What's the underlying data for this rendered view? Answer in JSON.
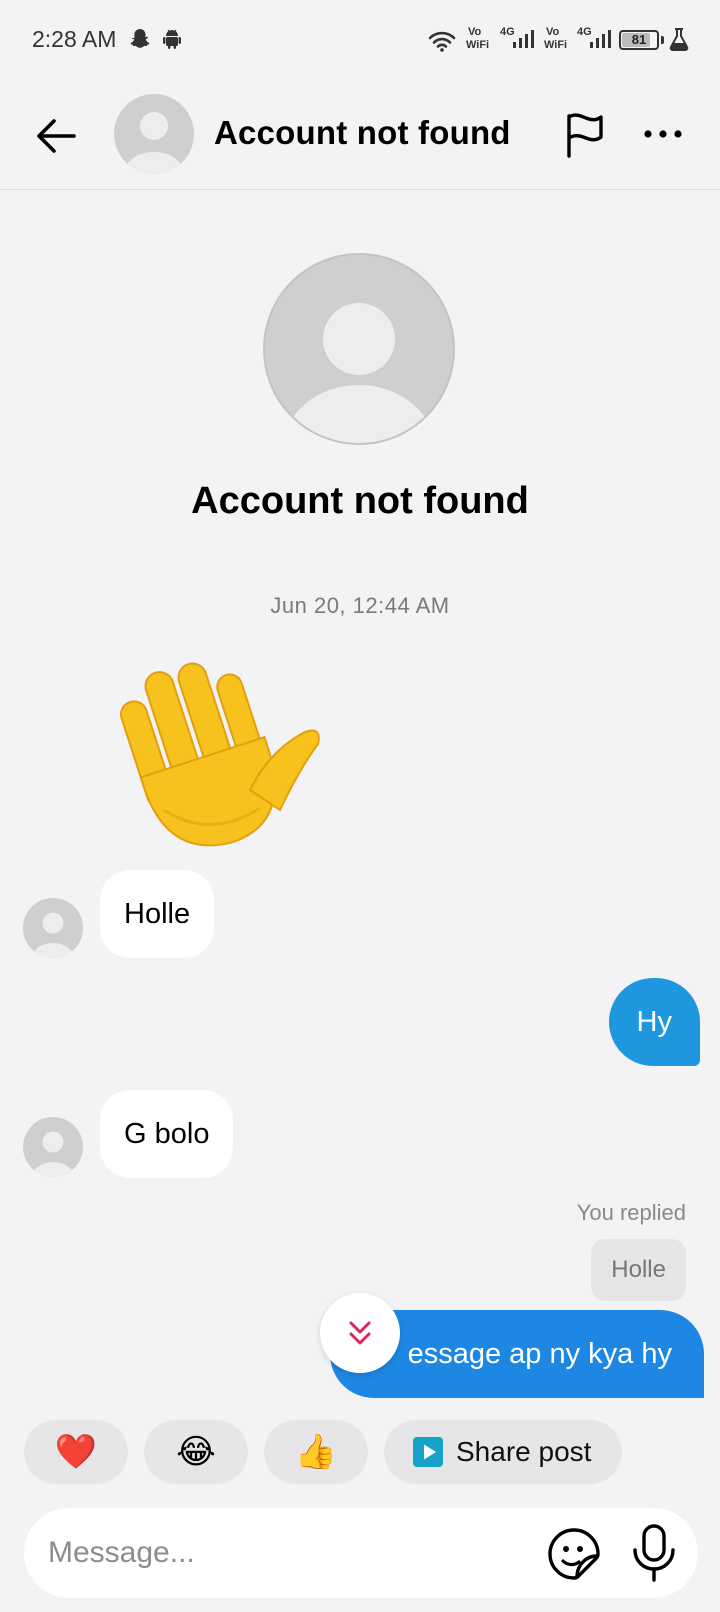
{
  "status_bar": {
    "time": "2:28 AM",
    "icons": [
      "snapchat-icon",
      "android-icon",
      "wifi-icon",
      "signal-icon",
      "flask-icon"
    ],
    "network_1": {
      "vo": "Vo",
      "wifi": "WiFi",
      "gen": "4G"
    },
    "network_2": {
      "vo": "Vo",
      "wifi": "WiFi",
      "gen": "4G"
    },
    "battery": {
      "label": "81",
      "level": 81
    }
  },
  "header": {
    "title": "Account not found",
    "icons": [
      "back-arrow-icon",
      "flag-icon",
      "more-icon"
    ]
  },
  "profile": {
    "name": "Account not found"
  },
  "conversation": {
    "timestamp": "Jun 20, 12:44 AM",
    "messages": [
      {
        "direction": "incoming",
        "type": "emoji",
        "content": "👋"
      },
      {
        "direction": "incoming",
        "text": "Holle"
      },
      {
        "direction": "outgoing",
        "text": "Hy"
      },
      {
        "direction": "incoming",
        "text": "G bolo"
      },
      {
        "direction": "outgoing",
        "replied_label": "You replied",
        "quoted": "Holle",
        "text": "essage ap ny kya hy"
      }
    ]
  },
  "quick_replies": [
    {
      "emoji": "❤️"
    },
    {
      "emoji": "😂"
    },
    {
      "emoji": "👍"
    },
    {
      "label": "Share post",
      "icon": "share-post-icon"
    }
  ],
  "composer": {
    "placeholder": "Message...",
    "icons": [
      "sticker-icon",
      "mic-icon"
    ]
  },
  "colors": {
    "background": "#f3f3f5",
    "outgoing_bubble": "#1f96e0",
    "outgoing_bubble_last": "#1e87e3",
    "incoming_bubble": "#ffffff",
    "accent_pink": "#e0245e",
    "share_icon": "#17a3c9"
  }
}
